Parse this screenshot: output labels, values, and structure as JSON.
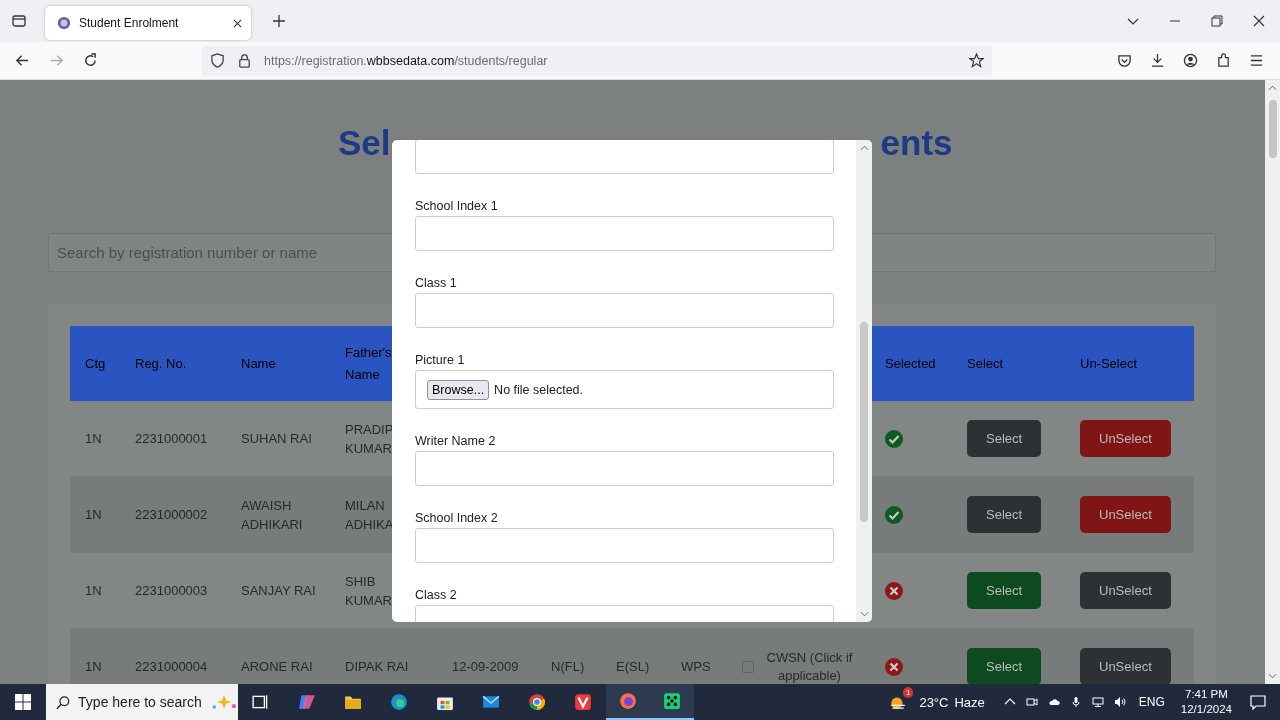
{
  "browser": {
    "tab": {
      "title": "Student Enrolment"
    },
    "url": {
      "prefix": "https://registration.",
      "domain": "wbbsedata.com",
      "path": "/students/regular"
    }
  },
  "page": {
    "title_parts": [
      "Sel",
      "ents"
    ],
    "search": {
      "placeholder": "Search by registration number or name"
    },
    "table": {
      "columns": [
        {
          "label": "Ctg"
        },
        {
          "label": "Reg. No."
        },
        {
          "label": "Name"
        },
        {
          "label": "Father's Name"
        },
        {
          "label": "Selected"
        },
        {
          "label": "Select"
        },
        {
          "label": "Un-Select"
        }
      ],
      "rows": [
        {
          "ctg": "1N",
          "reg_no": "2231000001",
          "name": "SUHAN RAI",
          "fathers_name": "PRADIP KUMAR",
          "selected": true,
          "select_button": "Select",
          "unselect_button": "UnSelect"
        },
        {
          "ctg": "1N",
          "reg_no": "2231000002",
          "name": "AWAISH ADHIKARI",
          "fathers_name": "MILAN ADHIKA",
          "selected": true,
          "select_button": "Select",
          "unselect_button": "UnSelect"
        },
        {
          "ctg": "1N",
          "reg_no": "2231000003",
          "name": "SANJAY RAI",
          "fathers_name": "SHIB KUMAR",
          "selected": false,
          "select_button": "Select",
          "unselect_button": "UnSelect"
        },
        {
          "ctg": "1N",
          "reg_no": "2231000004",
          "name": "ARONE RAI",
          "fathers_name": "DIPAK RAI",
          "dob": "12-09-2009",
          "column_6": "N(FL)",
          "column_7": "E(SL)",
          "column_8": "WPS",
          "cwsn": {
            "label": "CWSN (Click if applicable)",
            "checked": false
          },
          "selected": false,
          "select_button": "Select",
          "unselect_button": "UnSelect"
        }
      ]
    }
  },
  "modal": {
    "fields": [
      {
        "kind": "text"
      },
      {
        "kind": "text",
        "label": "School Index 1"
      },
      {
        "kind": "text",
        "label": "Class 1"
      },
      {
        "kind": "file",
        "label": "Picture 1",
        "button": "Browse...",
        "status": "No file selected."
      },
      {
        "kind": "text",
        "label": "Writer Name 2"
      },
      {
        "kind": "text",
        "label": "School Index 2"
      },
      {
        "kind": "text",
        "label": "Class 2"
      }
    ]
  },
  "taskbar": {
    "search": {
      "placeholder": "Type here to search"
    },
    "weather": {
      "badge": "1",
      "temperature": "23°C",
      "condition": "Haze"
    },
    "language": "ENG",
    "time": "7:41 PM",
    "date": "12/1/2024"
  }
}
